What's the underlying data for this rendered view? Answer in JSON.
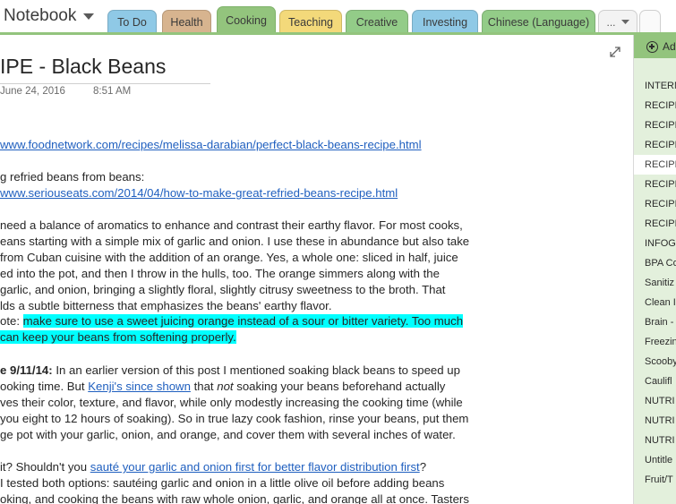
{
  "notebook": {
    "title": "Notebook"
  },
  "tabs": [
    {
      "label": "To Do",
      "color": "#8fc9e6"
    },
    {
      "label": "Health",
      "color": "#d7b48f"
    },
    {
      "label": "Cooking",
      "color": "#93c47d",
      "active": true
    },
    {
      "label": "Teaching",
      "color": "#f3d97a"
    },
    {
      "label": "Creative",
      "color": "#93cc88"
    },
    {
      "label": "Investing",
      "color": "#8fc9e6"
    },
    {
      "label": "Chinese (Language)",
      "color": "#93cc88"
    }
  ],
  "tabs_more_label": "...",
  "page": {
    "title": "IPE - Black Beans",
    "date": "June 24, 2016",
    "time": "8:51 AM",
    "link1": "www.foodnetwork.com/recipes/melissa-darabian/perfect-black-beans-recipe.html",
    "line_refried": "g refried beans from beans:",
    "link2": "www.seriouseats.com/2014/04/how-to-make-great-refried-beans-recipe.html",
    "para1": [
      "need a balance of aromatics to enhance and contrast their earthy flavor. For most cooks,",
      "eans starting with a simple mix of garlic and onion. I use these in abundance but also take",
      " from Cuban cuisine with the addition of an orange. Yes, a whole one: sliced in half, juice",
      "ed into the pot, and then I throw in the hulls, too. The orange simmers along with the",
      " garlic, and onion, bringing a slightly floral, slightly citrusy sweetness to the broth. That",
      "lds a subtle bitterness that emphasizes the beans' earthy flavor."
    ],
    "note_prefix": "ote: ",
    "note_hl1": "make sure to use a sweet juicing orange instead of a sour or bitter variety. Too much",
    "note_hl2": " can keep your beans from softening properly.",
    "update_bold": "e 9/11/14:",
    "update_rest": " In an earlier version of this post I mentioned soaking black beans to speed up",
    "update_l2": "ooking time. But ",
    "kenji_link": "Kenji's since shown",
    "update_l2b": " that ",
    "update_not": "not",
    "update_l2c": " soaking your beans beforehand actually",
    "update_l3": "ves their color, texture, and flavor, while only modestly increasing the cooking time (while",
    "update_l4": "you eight to 12 hours of soaking). So in true lazy cook fashion, rinse your beans, put them",
    "update_l5": "ge pot with your garlic, onion, and orange, and cover them with several inches of water.",
    "q_prefix": "it? Shouldn't you ",
    "saute_link": "sauté your garlic and onion first for better flavor distribution first",
    "q_suffix": "?",
    "tested_l1": "I tested both options: sautéing garlic and onion in a little olive oil before adding beans",
    "tested_l2": "oking, and cooking the beans with raw whole onion, garlic, and orange all at once. Tasters"
  },
  "sidebar": {
    "add_label": "Ad",
    "pages": [
      "INTERN",
      "RECIPE",
      "RECIPE",
      "RECIPE",
      "RECIPE",
      "RECIPE",
      "RECIPE",
      "RECIPE",
      "INFOG",
      "BPA Co",
      "Sanitiz",
      "Clean I",
      "Brain -",
      "Freezin",
      "Scooby",
      "Caulifl",
      "NUTRI",
      "NUTRI",
      "NUTRI",
      "Untitle",
      "Fruit/T"
    ],
    "selected_index": 4
  }
}
